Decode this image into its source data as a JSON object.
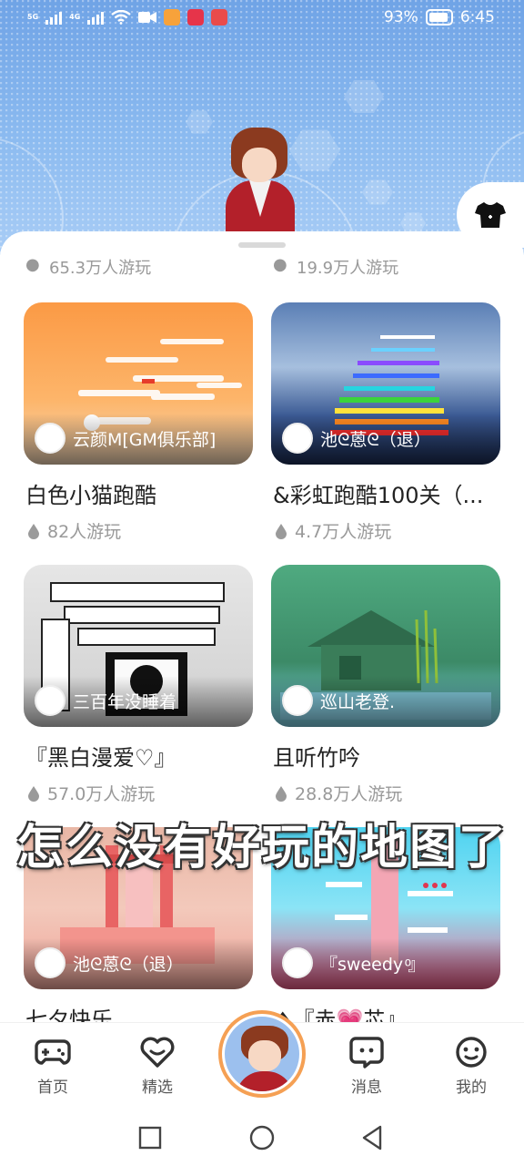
{
  "status_bar": {
    "network_1": "5G",
    "network_2": "4G",
    "battery": "93%",
    "time": "6:45"
  },
  "cut_row": {
    "left_plays": "65.3万人游玩",
    "right_plays": "19.9万人游玩"
  },
  "cards": [
    {
      "author": "云颜M[GM俱乐部]",
      "title": "白色小猫跑酷",
      "plays": "82人游玩"
    },
    {
      "author": "池ᘓ蒽ᘓ（退）",
      "title": "&彩虹跑酷100关（...",
      "plays": "4.7万人游玩"
    },
    {
      "author": "三百年没睡着",
      "title": "『黑白漫爱♡』",
      "plays": "57.0万人游玩"
    },
    {
      "author": "巡山老登.",
      "title": "且听竹吟",
      "plays": "28.8万人游玩"
    },
    {
      "author": "池ᘓ蒽ᘓ（退）",
      "title": "七夕快乐",
      "plays": ""
    },
    {
      "author": "『sweedy ͦ』",
      "title": "♦『赤💗芯』",
      "plays": ""
    }
  ],
  "overlay_caption": "怎么没有好玩的地图了",
  "nav": {
    "home": "首页",
    "featured": "精选",
    "messages": "消息",
    "mine": "我的"
  },
  "colors": {
    "accent_orange": "#f5a054",
    "hero_blue": "#7fb0ea"
  }
}
